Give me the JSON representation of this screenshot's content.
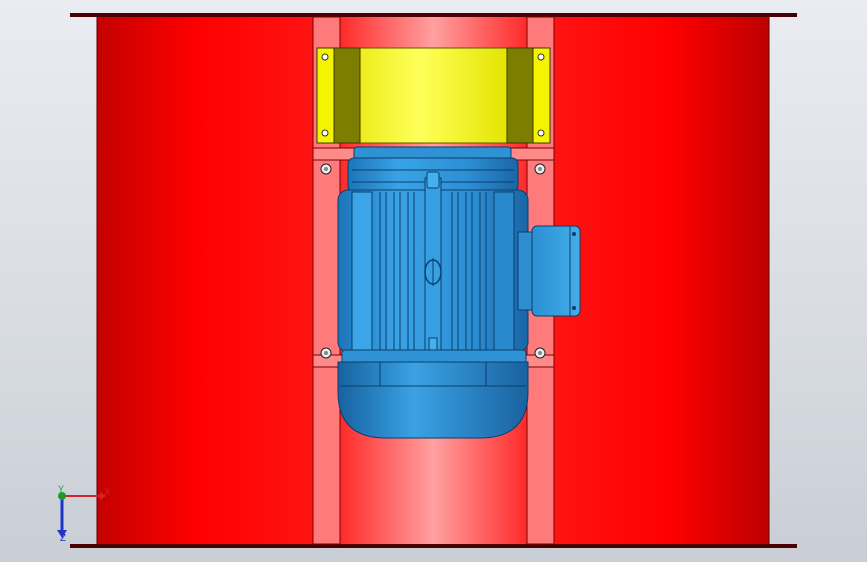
{
  "viewport": {
    "background": "#dde1e6"
  },
  "model": {
    "housing_color": "#f20000",
    "housing_highlight": "#ff6f6f",
    "panel_color": "#ff7f7f",
    "bracket_color": "#f2f200",
    "bracket_end_color": "#7d7d00",
    "motor_color": "#2e93d6",
    "motor_dark": "#0d4f86"
  },
  "triad": {
    "x_label": "X",
    "y_label": "Y",
    "z_label": "Z",
    "x_color": "#d4242a",
    "y_color": "#1c9a2c",
    "z_color": "#2034c8"
  },
  "icons": {
    "axes": "coordinate-triad-icon",
    "bolt": "bolt-icon"
  }
}
